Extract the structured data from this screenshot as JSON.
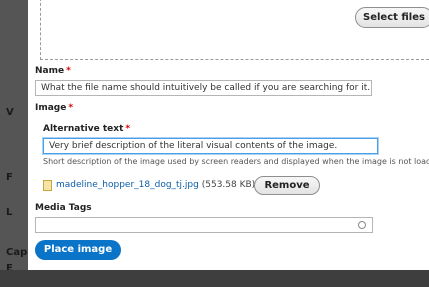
{
  "dropzone": {
    "select_files_label": "Select files"
  },
  "name_field": {
    "label": "Name",
    "required_mark": "*",
    "value": "What the file name should intuitively be called if you are searching for it."
  },
  "image_field": {
    "label": "Image",
    "required_mark": "*",
    "alt_text": {
      "label": "Alternative text",
      "required_mark": "*",
      "value": "Very brief description of the literal visual contents of the image.",
      "description": "Short description of the image used by screen readers and displayed when the image is not load"
    },
    "file": {
      "name": "madeline_hopper_18_dog_tj.jpg",
      "size": "(553.58 KB)",
      "remove_label": "Remove"
    }
  },
  "media_tags": {
    "label": "Media Tags",
    "value": ""
  },
  "place_image_label": "Place image",
  "backdrop": {
    "caption_fragment": "Cap",
    "letter_e": "E",
    "letter_f": "F",
    "letter_l": "L",
    "letter_v": "V"
  },
  "colors": {
    "primary_button": "#0a74c9",
    "link": "#0b5ea8",
    "required": "#d80000",
    "focus": "#4aa0e6"
  },
  "icons": [
    "file-image-icon",
    "autocomplete-circle-icon"
  ]
}
